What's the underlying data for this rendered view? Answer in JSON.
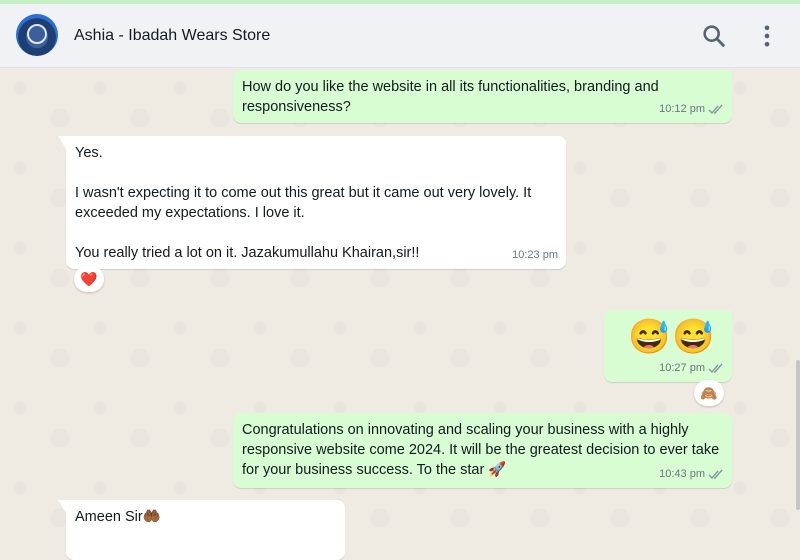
{
  "header": {
    "contact_name": "Ashia - Ibadah Wears Store"
  },
  "messages": [
    {
      "direction": "outgoing",
      "text": "How do you like the website in all its functionalities, branding and responsiveness?",
      "time": "10:12 pm",
      "status": "read"
    },
    {
      "direction": "incoming",
      "lines": [
        "Yes.",
        "",
        "I wasn't expecting it to come out this great but it came out very lovely. It exceeded my expectations. I love it.",
        "",
        "You really tried a lot on it.  Jazakumullahu Khairan,sir!!"
      ],
      "time": "10:23 pm",
      "reaction": "❤️"
    },
    {
      "direction": "outgoing",
      "text": "😅😅",
      "time": "10:27 pm",
      "status": "read",
      "reaction": "🙈"
    },
    {
      "direction": "outgoing",
      "text": "Congratulations on innovating and scaling your business with a highly responsive website come 2024.  It will be the greatest decision to ever take for your business success. To the star 🚀",
      "time": "10:43 pm",
      "status": "read"
    },
    {
      "direction": "incoming",
      "text": "Ameen Sir🤲🏾"
    }
  ],
  "icons": {
    "search": "search-icon",
    "menu": "kebab-menu-icon",
    "read_receipt": "double-check-icon"
  },
  "colors": {
    "outgoing_bubble": "#d9fdd3",
    "incoming_bubble": "#ffffff",
    "read_ticks": "#8696a0",
    "chat_background": "#efeae2"
  }
}
